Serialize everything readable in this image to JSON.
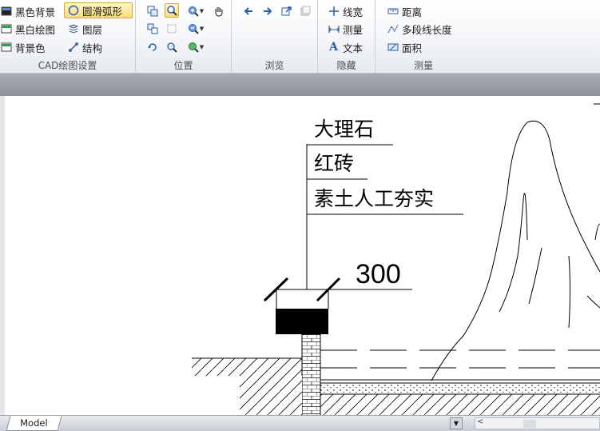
{
  "ribbon": {
    "groups": [
      {
        "label": "CAD绘图设置",
        "buttons": [
          "黑色背景",
          "圆滑弧形",
          "黑白绘图",
          "图层",
          "背景色",
          "结构"
        ]
      },
      {
        "label": "位置"
      },
      {
        "label": "浏览"
      },
      {
        "label": "隐藏",
        "buttons": [
          "线宽",
          "测量",
          "文本"
        ]
      },
      {
        "label": "测量",
        "buttons": [
          "距离",
          "多段线长度",
          "面积"
        ]
      }
    ]
  },
  "drawing": {
    "labels": [
      "大理石",
      "红砖",
      "素土人工夯实"
    ],
    "dimension": "300"
  },
  "bottom": {
    "model_tab": "Model",
    "scroll_left": "<"
  },
  "colors": {
    "active_button": "#fddc78",
    "band": "#a0a4aa"
  }
}
